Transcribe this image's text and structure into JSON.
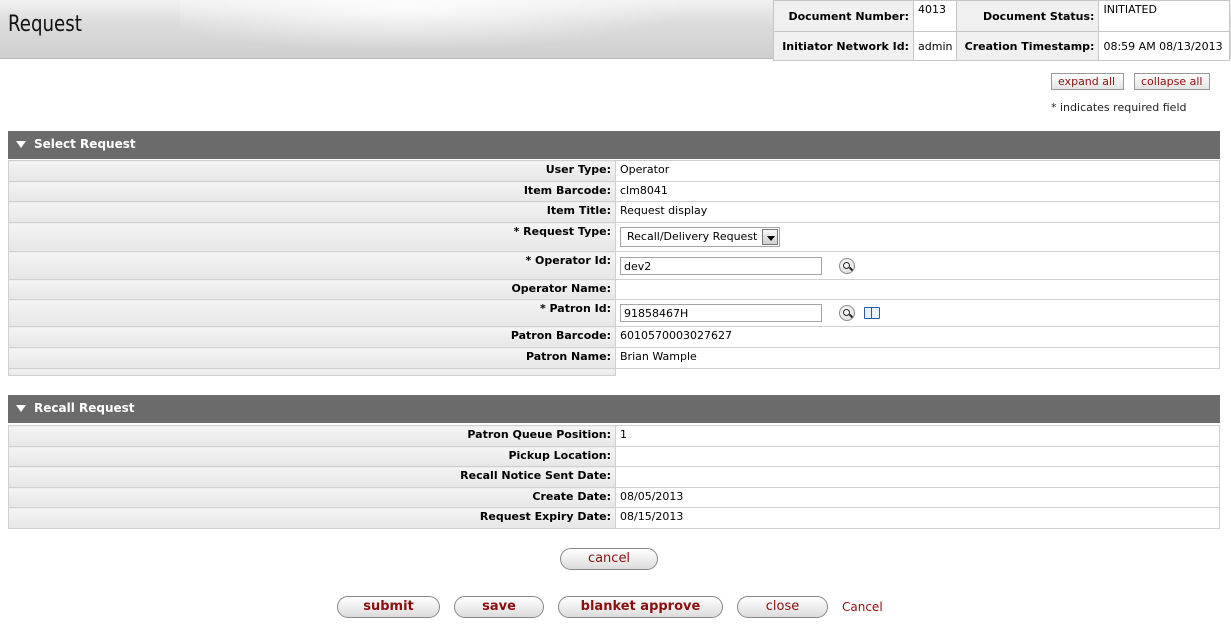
{
  "header": {
    "title": "Request",
    "document_number_label": "Document Number:",
    "document_number": "4013",
    "document_status_label": "Document Status:",
    "document_status": "INITIATED",
    "initiator_label": "Initiator Network Id:",
    "initiator": "admin",
    "creation_label": "Creation Timestamp:",
    "creation": "08:59 AM 08/13/2013"
  },
  "controls": {
    "expand_all": "expand all",
    "collapse_all": "collapse all",
    "required_note": "* indicates required field"
  },
  "select_request": {
    "title": "Select Request",
    "user_type_label": "User Type:",
    "user_type": "Operator",
    "item_barcode_label": "Item Barcode:",
    "item_barcode": "clm8041",
    "item_title_label": "Item Title:",
    "item_title": "Request display",
    "request_type_label": "* Request Type:",
    "request_type": "Recall/Delivery Request",
    "operator_id_label": "* Operator Id:",
    "operator_id": "dev2",
    "operator_name_label": "Operator Name:",
    "operator_name": "",
    "patron_id_label": "* Patron Id:",
    "patron_id": "91858467H",
    "patron_barcode_label": "Patron Barcode:",
    "patron_barcode": "6010570003027627",
    "patron_name_label": "Patron Name:",
    "patron_name": "Brian Wample"
  },
  "recall_request": {
    "title": "Recall Request",
    "queue_label": "Patron Queue Position:",
    "queue": "1",
    "pickup_label": "Pickup Location:",
    "pickup": "",
    "notice_label": "Recall Notice Sent Date:",
    "notice": "",
    "create_label": "Create Date:",
    "create": "08/05/2013",
    "expiry_label": "Request Expiry Date:",
    "expiry": "08/15/2013"
  },
  "buttons": {
    "cancel": "cancel",
    "submit": "submit",
    "save": "save",
    "blanket_approve": "blanket approve",
    "close": "close",
    "cancel_link": "Cancel"
  }
}
